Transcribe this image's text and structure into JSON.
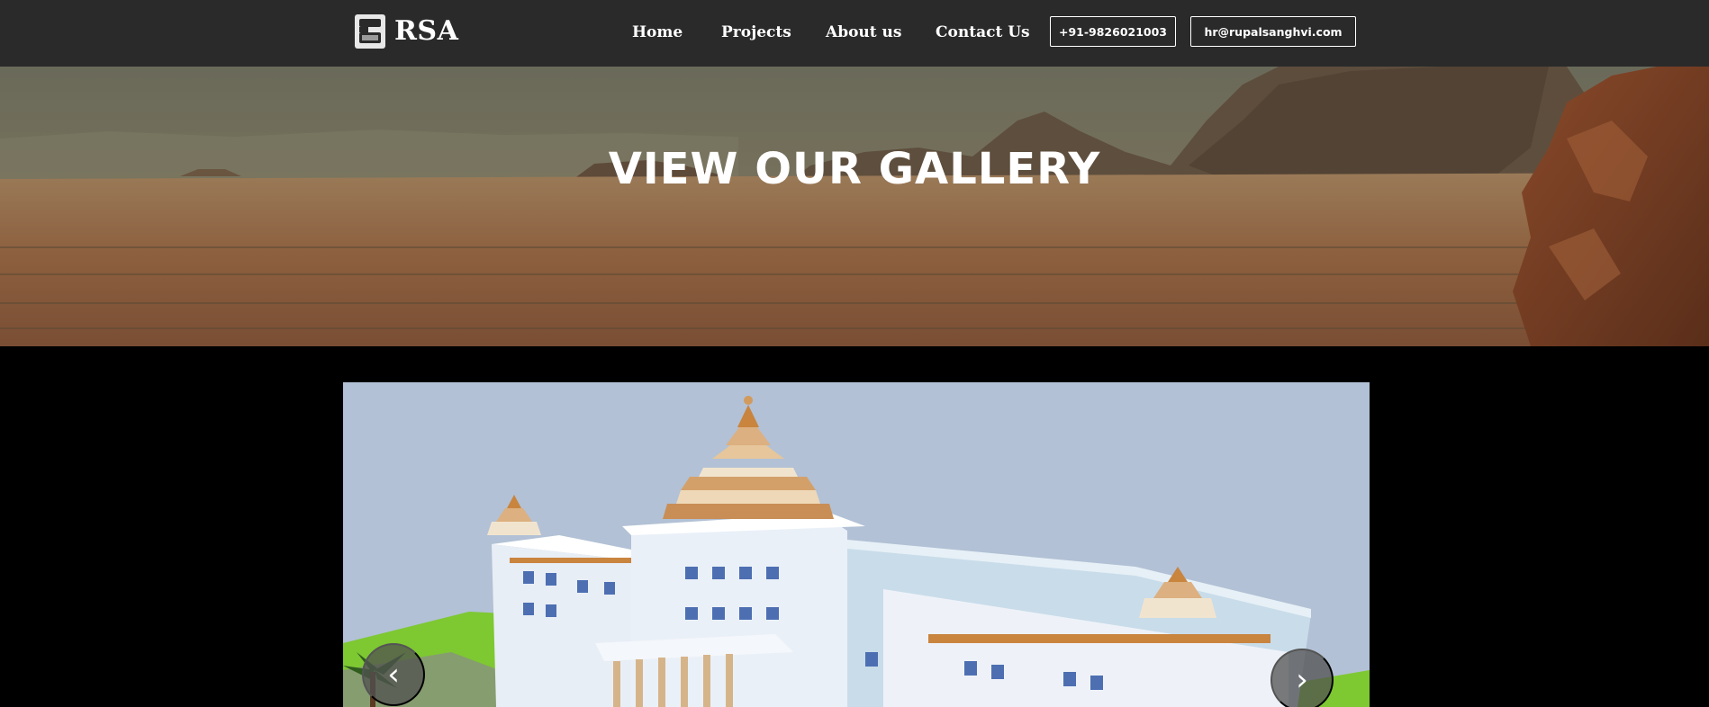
{
  "brand": {
    "name": "RSA",
    "logo_icon": "rsa-logo-icon"
  },
  "nav": {
    "items": [
      {
        "label": "Home"
      },
      {
        "label": "Projects"
      },
      {
        "label": "About us"
      },
      {
        "label": "Contact Us"
      }
    ],
    "phone": "+91-9826021003",
    "email": "hr@rupalsanghvi.com"
  },
  "hero": {
    "title": "VIEW OUR GALLERY"
  },
  "gallery": {
    "prev_label": "‹",
    "next_label": "›"
  },
  "colors": {
    "navbar_bg": "#2a2a2a",
    "page_bg": "#000000",
    "text": "#ffffff"
  }
}
